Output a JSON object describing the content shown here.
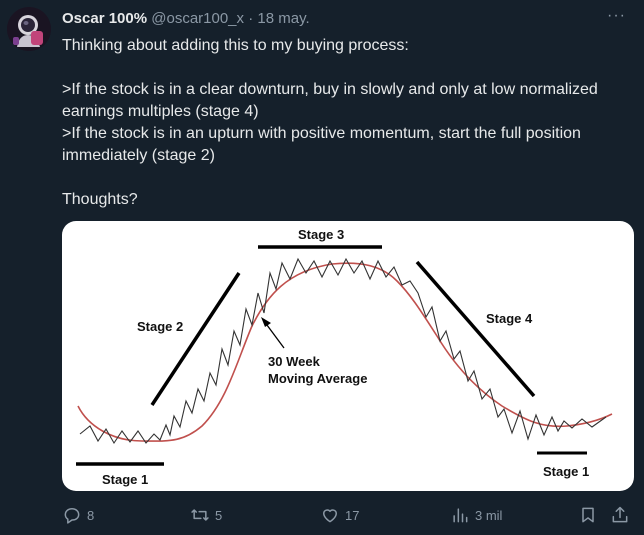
{
  "tweet": {
    "author_name": "Oscar 100%",
    "handle": "@oscar100_x",
    "separator": "·",
    "date": "18 may.",
    "more_label": "···",
    "lines": [
      "Thinking about adding this to my buying process:",
      ">If the stock is in a clear downturn, buy in slowly and only at low normalized earnings multiples (stage 4)",
      ">If the stock is in an upturn with positive momentum, start the full position immediately (stage 2)",
      "Thoughts?"
    ]
  },
  "chart": {
    "labels": {
      "stage1_left": "Stage 1",
      "stage2": "Stage 2",
      "stage3": "Stage 3",
      "stage4": "Stage 4",
      "stage1_right": "Stage 1",
      "ma_line1": "30 Week",
      "ma_line2": "Moving Average"
    },
    "colors": {
      "price": "#333333",
      "moving_average": "#c0504d",
      "trend_bars": "#000000"
    }
  },
  "actions": {
    "replies": "8",
    "retweets": "5",
    "likes": "17",
    "views": "3 mil"
  },
  "icons": [
    "avatar",
    "more-icon",
    "reply-icon",
    "retweet-icon",
    "like-icon",
    "views-icon",
    "bookmark-icon",
    "share-icon"
  ]
}
